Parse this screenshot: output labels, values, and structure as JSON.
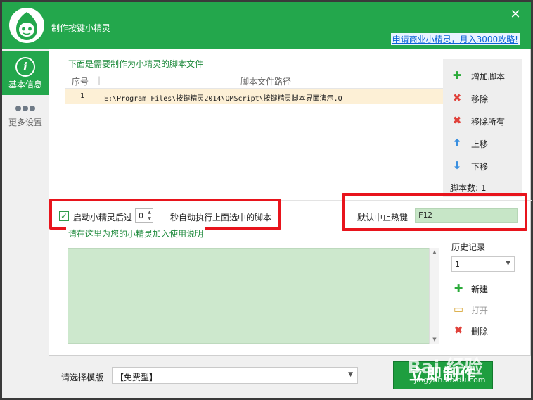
{
  "window": {
    "title": "制作按键小精灵",
    "close_glyph": "✕",
    "promo_link": "申请商业小精灵，月入3000攻略!"
  },
  "sidebar": {
    "items": [
      {
        "label": "基本信息",
        "icon": "info-icon",
        "active": true
      },
      {
        "label": "更多设置",
        "icon": "more-dots-icon",
        "active": false
      }
    ]
  },
  "scripts": {
    "group_title": "下面是需要制作为小精灵的脚本文件",
    "columns": [
      "序号",
      "脚本文件路径"
    ],
    "column_sep": "|",
    "rows": [
      {
        "num": "1",
        "path": "E:\\Program Files\\按键精灵2014\\QMScript\\按键精灵脚本界面演示.Q"
      }
    ],
    "buttons": {
      "add": "增加脚本",
      "remove": "移除",
      "remove_all": "移除所有",
      "move_up": "上移",
      "move_down": "下移"
    },
    "count_label": "脚本数:  1"
  },
  "autorun": {
    "checked": true,
    "check_glyph": "✓",
    "before": "启动小精灵后过",
    "seconds": "0",
    "after": "秒自动执行上面选中的脚本"
  },
  "hotkey": {
    "label": "默认中止热键",
    "value": "F12"
  },
  "description": {
    "group_title": "请在这里为您的小精灵加入使用说明"
  },
  "history": {
    "label": "历史记录",
    "selected": "1",
    "buttons": {
      "new": "新建",
      "open": "打开",
      "delete": "删除"
    }
  },
  "template": {
    "label": "请选择模版",
    "selected": "【免费型】"
  },
  "make_button": "立即制作",
  "watermark": {
    "brand": "Bai 经验",
    "url": "jingyan.baidu.com"
  },
  "colors": {
    "brand_green": "#23a74c",
    "highlight_red": "#e8141c",
    "link_blue": "#0b63d6",
    "row_highlight": "#fdf0d6",
    "field_green": "#cde8cd"
  }
}
